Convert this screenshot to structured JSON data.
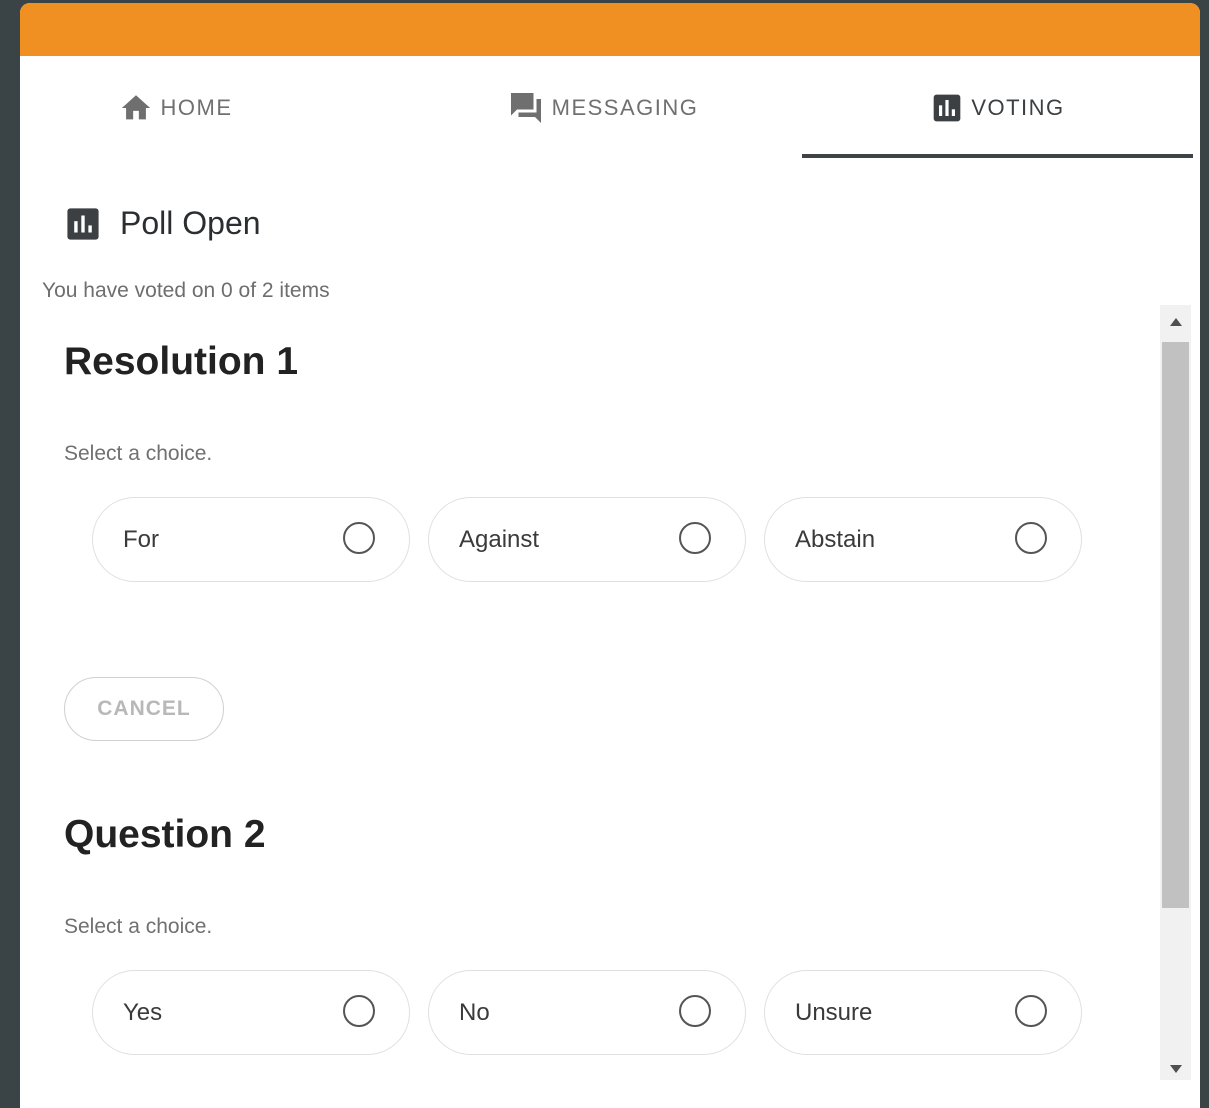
{
  "colors": {
    "accent": "#f09022",
    "tab_underline": "#3d4447",
    "background": "#3a4346"
  },
  "tabs": [
    {
      "label": "HOME",
      "icon": "home-icon",
      "active": false
    },
    {
      "label": "MESSAGING",
      "icon": "chat-icon",
      "active": false
    },
    {
      "label": "VOTING",
      "icon": "poll-icon",
      "active": true
    }
  ],
  "poll": {
    "status_title": "Poll Open",
    "progress_text": "You have voted on 0 of 2 items"
  },
  "items": [
    {
      "title": "Resolution 1",
      "hint": "Select a choice.",
      "choices": [
        "For",
        "Against",
        "Abstain"
      ],
      "cancel_label": "CANCEL"
    },
    {
      "title": "Question 2",
      "hint": "Select a choice.",
      "choices": [
        "Yes",
        "No",
        "Unsure"
      ]
    }
  ]
}
